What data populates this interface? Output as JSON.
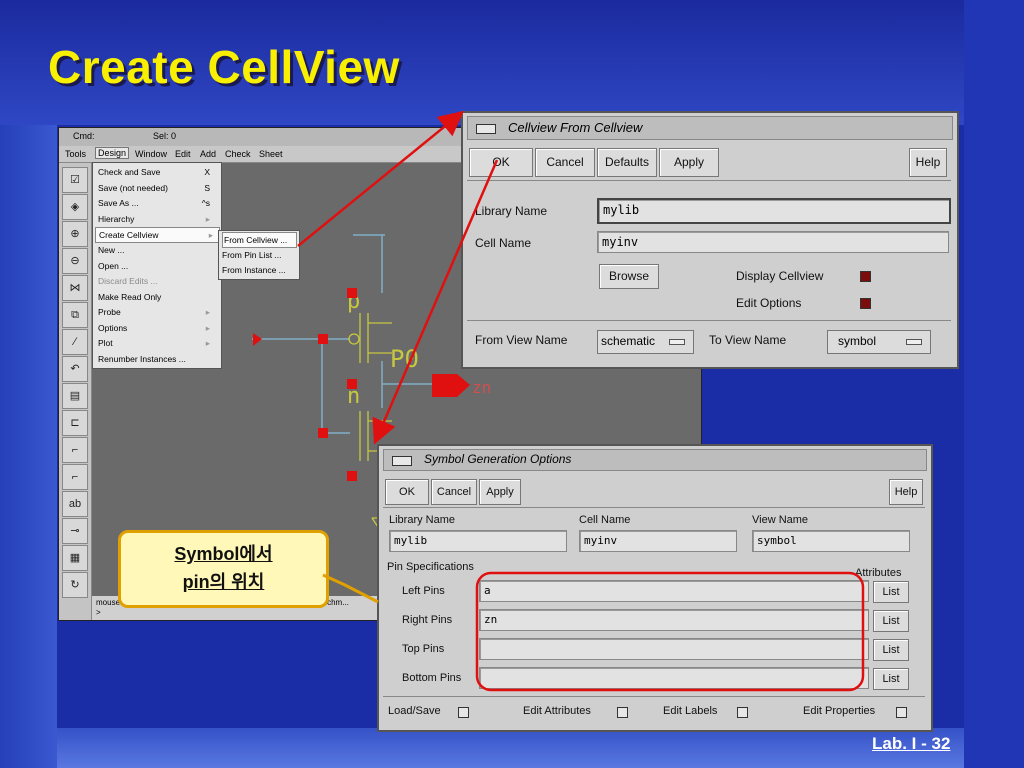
{
  "slide": {
    "title": "Create CellView",
    "footer": "Lab. I - 32"
  },
  "schematic": {
    "cmd_label": "Cmd:",
    "sel_label": "Sel: 0",
    "menus": [
      "Tools",
      "Design",
      "Window",
      "Edit",
      "Add",
      "Check",
      "Sheet"
    ],
    "active_menu": "Design",
    "design_menu": [
      {
        "label": "Check and Save",
        "shortcut": "X"
      },
      {
        "label": "Save (not needed)",
        "shortcut": "S"
      },
      {
        "label": "Save As ...",
        "shortcut": "^s"
      },
      {
        "label": "Hierarchy",
        "shortcut": "▸"
      },
      {
        "label": "Create Cellview",
        "shortcut": "▸"
      },
      {
        "label": "New ...",
        "shortcut": ""
      },
      {
        "label": "Open ...",
        "shortcut": ""
      },
      {
        "label": "Discard Edits ...",
        "shortcut": ""
      },
      {
        "label": "Make Read Only",
        "shortcut": ""
      },
      {
        "label": "Probe",
        "shortcut": "▸"
      },
      {
        "label": "Options",
        "shortcut": "▸"
      },
      {
        "label": "Plot",
        "shortcut": "▸"
      },
      {
        "label": "Renumber Instances ...",
        "shortcut": ""
      }
    ],
    "create_cellview_submenu": [
      "From Cellview ...",
      "From Pin List ...",
      "From Instance ..."
    ],
    "canvas_labels": {
      "pmos": "P0",
      "pin": "zn",
      "p_letter": "p",
      "n_letter": "n"
    },
    "status_line1": "mouse L: schSingleSelectPt()",
    "status_line1b": "M: schm...",
    "status_line2": ">"
  },
  "cellview_dialog": {
    "title": "Cellview From Cellview",
    "buttons": {
      "ok": "OK",
      "cancel": "Cancel",
      "defaults": "Defaults",
      "apply": "Apply",
      "help": "Help"
    },
    "library_name_label": "Library Name",
    "library_name_value": "mylib",
    "cell_name_label": "Cell Name",
    "cell_name_value": "myinv",
    "browse_label": "Browse",
    "display_cellview_label": "Display Cellview",
    "edit_options_label": "Edit Options",
    "from_view_label": "From View Name",
    "from_view_value": "schematic",
    "to_view_label": "To View Name",
    "to_view_value": "symbol"
  },
  "symbol_dialog": {
    "title": "Symbol Generation Options",
    "buttons": {
      "ok": "OK",
      "cancel": "Cancel",
      "apply": "Apply",
      "help": "Help"
    },
    "library_name_label": "Library Name",
    "library_name_value": "mylib",
    "cell_name_label": "Cell Name",
    "cell_name_value": "myinv",
    "view_name_label": "View Name",
    "view_name_value": "symbol",
    "pin_spec_label": "Pin Specifications",
    "attributes_label": "Attributes",
    "left_pins_label": "Left Pins",
    "left_pins_value": "a",
    "right_pins_label": "Right Pins",
    "right_pins_value": "zn",
    "top_pins_label": "Top Pins",
    "top_pins_value": "",
    "bottom_pins_label": "Bottom Pins",
    "bottom_pins_value": "",
    "list_label": "List",
    "load_save_label": "Load/Save",
    "edit_attributes_label": "Edit Attributes",
    "edit_labels_label": "Edit Labels",
    "edit_properties_label": "Edit Properties"
  },
  "callout": {
    "line1": "Symbol에서",
    "line2": "pin의 위치"
  },
  "colors": {
    "title": "#f8f000",
    "annotation": "#e01010",
    "callout_border": "#e0a000",
    "wire": "#7fb0c8",
    "device": "#c8c840"
  }
}
